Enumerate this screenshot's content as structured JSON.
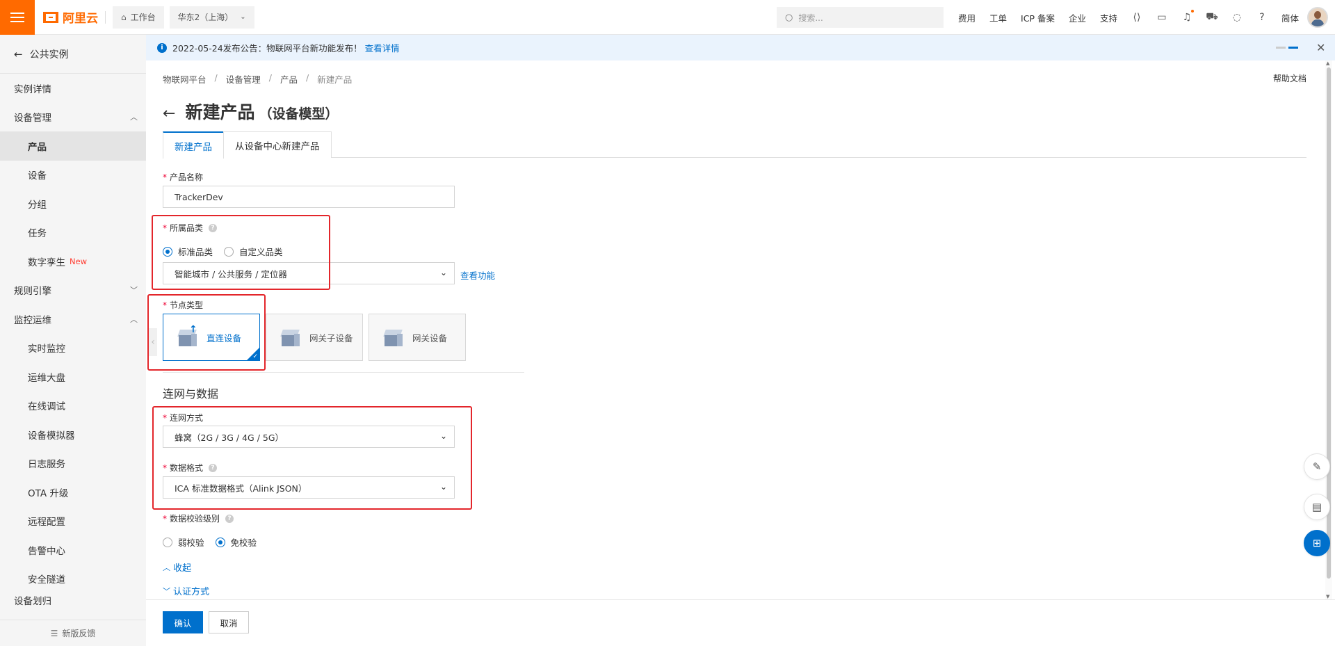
{
  "topbar": {
    "logo_text": "阿里云",
    "workbench": "工作台",
    "region": "华东2（上海）",
    "search_placeholder": "搜索...",
    "links": [
      "费用",
      "工单",
      "ICP 备案",
      "企业",
      "支持"
    ],
    "lang": "简体",
    "icons": [
      "code-icon",
      "terminal-icon",
      "bell-icon",
      "cart-icon",
      "bulb-icon",
      "help-icon"
    ]
  },
  "sidebar": {
    "back_label": "公共实例",
    "items": [
      {
        "label": "实例详情"
      },
      {
        "label": "设备管理"
      },
      {
        "label": "产品"
      },
      {
        "label": "设备"
      },
      {
        "label": "分组"
      },
      {
        "label": "任务"
      },
      {
        "label": "数字孪生",
        "badge": "New"
      },
      {
        "label": "规则引擎"
      },
      {
        "label": "监控运维"
      },
      {
        "label": "实时监控"
      },
      {
        "label": "运维大盘"
      },
      {
        "label": "在线调试"
      },
      {
        "label": "设备模拟器"
      },
      {
        "label": "日志服务"
      },
      {
        "label": "OTA 升级"
      },
      {
        "label": "远程配置"
      },
      {
        "label": "告警中心"
      },
      {
        "label": "安全隧道"
      },
      {
        "label": "设备划归"
      }
    ],
    "feedback": "新版反馈"
  },
  "announcement": {
    "text": "2022-05-24发布公告：物联网平台新功能发布！",
    "link": "查看详情"
  },
  "breadcrumb": [
    "物联网平台",
    "设备管理",
    "产品",
    "新建产品"
  ],
  "help_doc": "帮助文档",
  "page": {
    "title": "新建产品",
    "subtitle": "（设备模型）"
  },
  "tabs": [
    {
      "label": "新建产品",
      "active": true
    },
    {
      "label": "从设备中心新建产品",
      "active": false
    }
  ],
  "form": {
    "product_name_label": "产品名称",
    "product_name_value": "TrackerDev",
    "category_label": "所属品类",
    "category_options": [
      "标准品类",
      "自定义品类"
    ],
    "category_value": "智能城市 / 公共服务 / 定位器",
    "view_function": "查看功能",
    "node_type_label": "节点类型",
    "node_types": [
      "直连设备",
      "网关子设备",
      "网关设备"
    ],
    "section_title": "连网与数据",
    "network_label": "连网方式",
    "network_value": "蜂窝（2G / 3G / 4G / 5G）",
    "data_format_label": "数据格式",
    "data_format_value": "ICA 标准数据格式（Alink JSON）",
    "verify_label": "数据校验级别",
    "verify_options": [
      "弱校验",
      "免校验"
    ],
    "collapse": "收起",
    "auth": "认证方式"
  },
  "footer": {
    "confirm": "确认",
    "cancel": "取消"
  },
  "colors": {
    "brand": "#ff6a00",
    "primary": "#0070cc",
    "highlight": "#e3262b"
  }
}
